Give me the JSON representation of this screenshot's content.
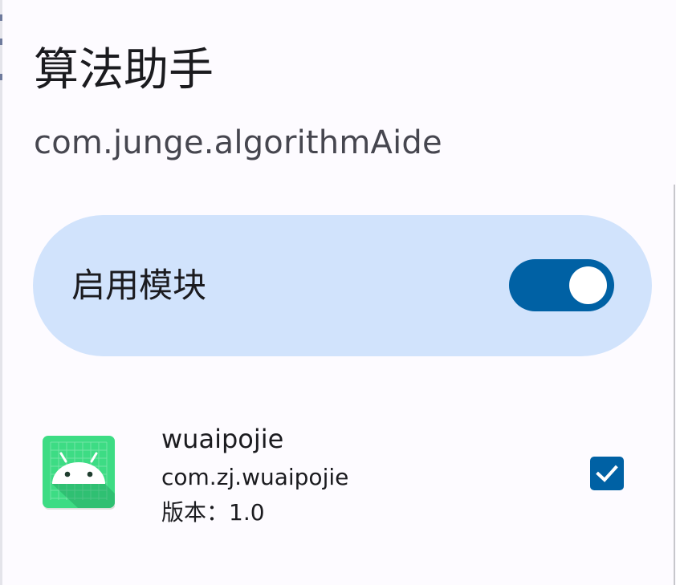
{
  "header": {
    "app_title": "算法助手",
    "package_name": "com.junge.algorithmAide"
  },
  "module_toggle": {
    "label": "启用模块",
    "enabled": true
  },
  "scope_list": [
    {
      "name": "wuaipojie",
      "package": "com.zj.wuaipojie",
      "version": "版本：1.0",
      "checked": true,
      "icon": "android-app-icon"
    }
  ],
  "colors": {
    "background": "#fdfbff",
    "card": "#d1e3fc",
    "accent": "#0061a4",
    "icon_green": "#3ddc84"
  }
}
